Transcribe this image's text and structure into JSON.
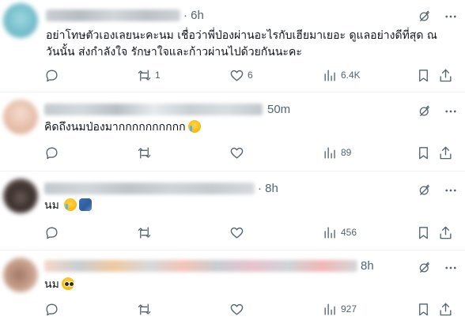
{
  "posts": [
    {
      "time": "· 6h",
      "text_lines": [
        "อย่าโทษตัวเองเลยนะคะนม เชื่อว่าพี่ป่องผ่านอะไรกับเฮียมาเยอะ ดูแลอย่างดีที่สุด ณ",
        "วันนั้น ส่งกำลังใจ รักษาใจและก้าวผ่านไปด้วยกันนะคะ"
      ],
      "replies": "",
      "reposts": "1",
      "likes": "6",
      "views": "6.4K"
    },
    {
      "time": "50m",
      "text_lines": [
        "คิดถึงนมป่องมากกกกกกกกกก"
      ],
      "emoji": [
        "loudly-crying-face-emoji"
      ],
      "replies": "",
      "reposts": "",
      "likes": "",
      "views": "89"
    },
    {
      "time": "· 8h",
      "text_lines": [
        "นม"
      ],
      "emoji": [
        "loudly-crying-face-emoji",
        "people-hugging-emoji"
      ],
      "replies": "",
      "reposts": "",
      "likes": "",
      "views": "456"
    },
    {
      "time": "8h",
      "text_lines": [
        "นม"
      ],
      "emoji": [
        "pleading-face-emoji"
      ],
      "replies": "",
      "reposts": "",
      "likes": "",
      "views": "927"
    }
  ],
  "icons": {
    "reply": "reply-icon",
    "repost": "repost-icon",
    "like": "like-icon",
    "views": "views-icon",
    "bookmark": "bookmark-icon",
    "share": "share-icon",
    "grok": "grok-icon",
    "more": "more-options-icon"
  },
  "colors": {
    "text": "#0f1419",
    "muted": "#536471",
    "divider": "#eff3f4"
  }
}
